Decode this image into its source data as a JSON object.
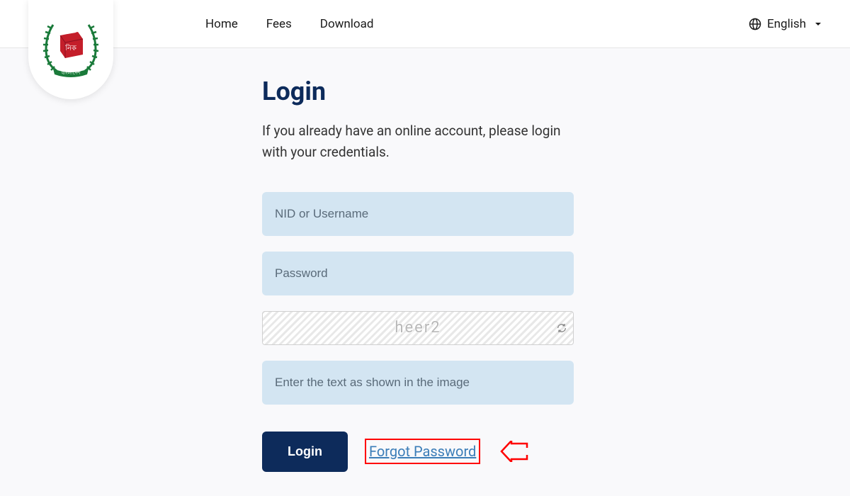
{
  "nav": {
    "home": "Home",
    "fees": "Fees",
    "download": "Download"
  },
  "language": {
    "label": "English"
  },
  "login": {
    "title": "Login",
    "subtitle": "If you already have an online account, please login with your credentials.",
    "username_placeholder": "NID or Username",
    "password_placeholder": "Password",
    "captcha_text": "heer2",
    "captcha_placeholder": "Enter the text as shown in the image",
    "login_button": "Login",
    "forgot_link": "Forgot Password"
  }
}
